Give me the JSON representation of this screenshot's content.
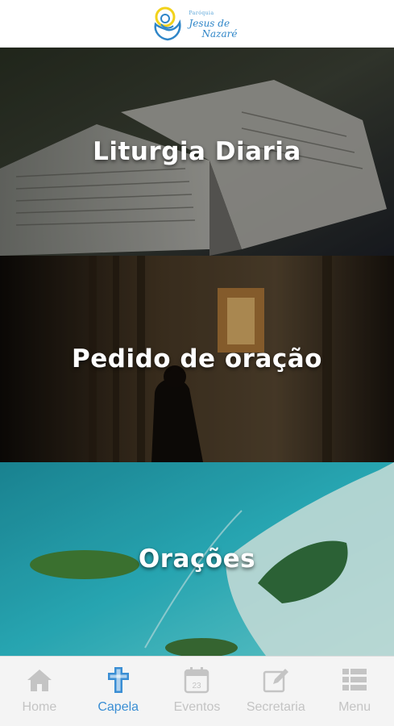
{
  "colors": {
    "accent": "#3a8ed4",
    "inactive": "#c4c4c4",
    "nav_background": "#f4f4f4"
  },
  "header": {
    "logo_icon": "parish-logo-icon",
    "logo_small": "Paróquia",
    "logo_line1": "Jesus de",
    "logo_line2": "Nazaré"
  },
  "cards": [
    {
      "label": "Liturgia Diaria",
      "image": "open-bible-photo"
    },
    {
      "label": "Pedido de oração",
      "image": "person-praying-chapel-photo"
    },
    {
      "label": "Orações",
      "image": "aerial-lagoon-photo"
    }
  ],
  "bottom_nav": {
    "active": "Capela",
    "items": [
      {
        "label": "Home",
        "icon": "home-icon"
      },
      {
        "label": "Capela",
        "icon": "cross-icon"
      },
      {
        "label": "Eventos",
        "icon": "calendar-icon",
        "calendar_day": "23"
      },
      {
        "label": "Secretaria",
        "icon": "edit-icon"
      },
      {
        "label": "Menu",
        "icon": "menu-list-icon"
      }
    ]
  }
}
